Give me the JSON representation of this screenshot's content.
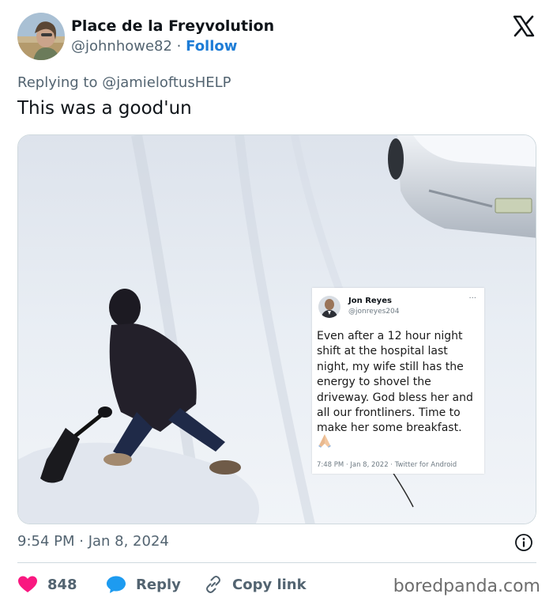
{
  "author": {
    "name": "Place de la Freyvolution",
    "handle": "@johnhowe82",
    "separator": " · ",
    "follow_label": "Follow"
  },
  "reply": {
    "prefix": "Replying to ",
    "mention": "@jamieloftusHELP"
  },
  "tweet": {
    "text": "This was a good'un",
    "timestamp": "9:54 PM · Jan 8, 2024"
  },
  "quoted_tweet": {
    "name": "Jon Reyes",
    "handle": "@jonreyes204",
    "more": "···",
    "lines": [
      "Even after a 12 hour night",
      "shift at the hospital last",
      "night, my wife still has the",
      "energy to shovel the",
      "driveway. God bless her and",
      "all our frontliners. Time to",
      "make her some breakfast."
    ],
    "emoji": "folded-hands",
    "meta": "7:48 PM · Jan 8, 2022 · Twitter for Android"
  },
  "actions": {
    "like_count": "848",
    "reply_label": "Reply",
    "copy_label": "Copy link"
  },
  "watermark": "boredpanda.com",
  "colors": {
    "link_blue": "#1d7cd6",
    "like_red": "#f91880",
    "reply_blue": "#1d9bf0",
    "muted": "#536471"
  }
}
